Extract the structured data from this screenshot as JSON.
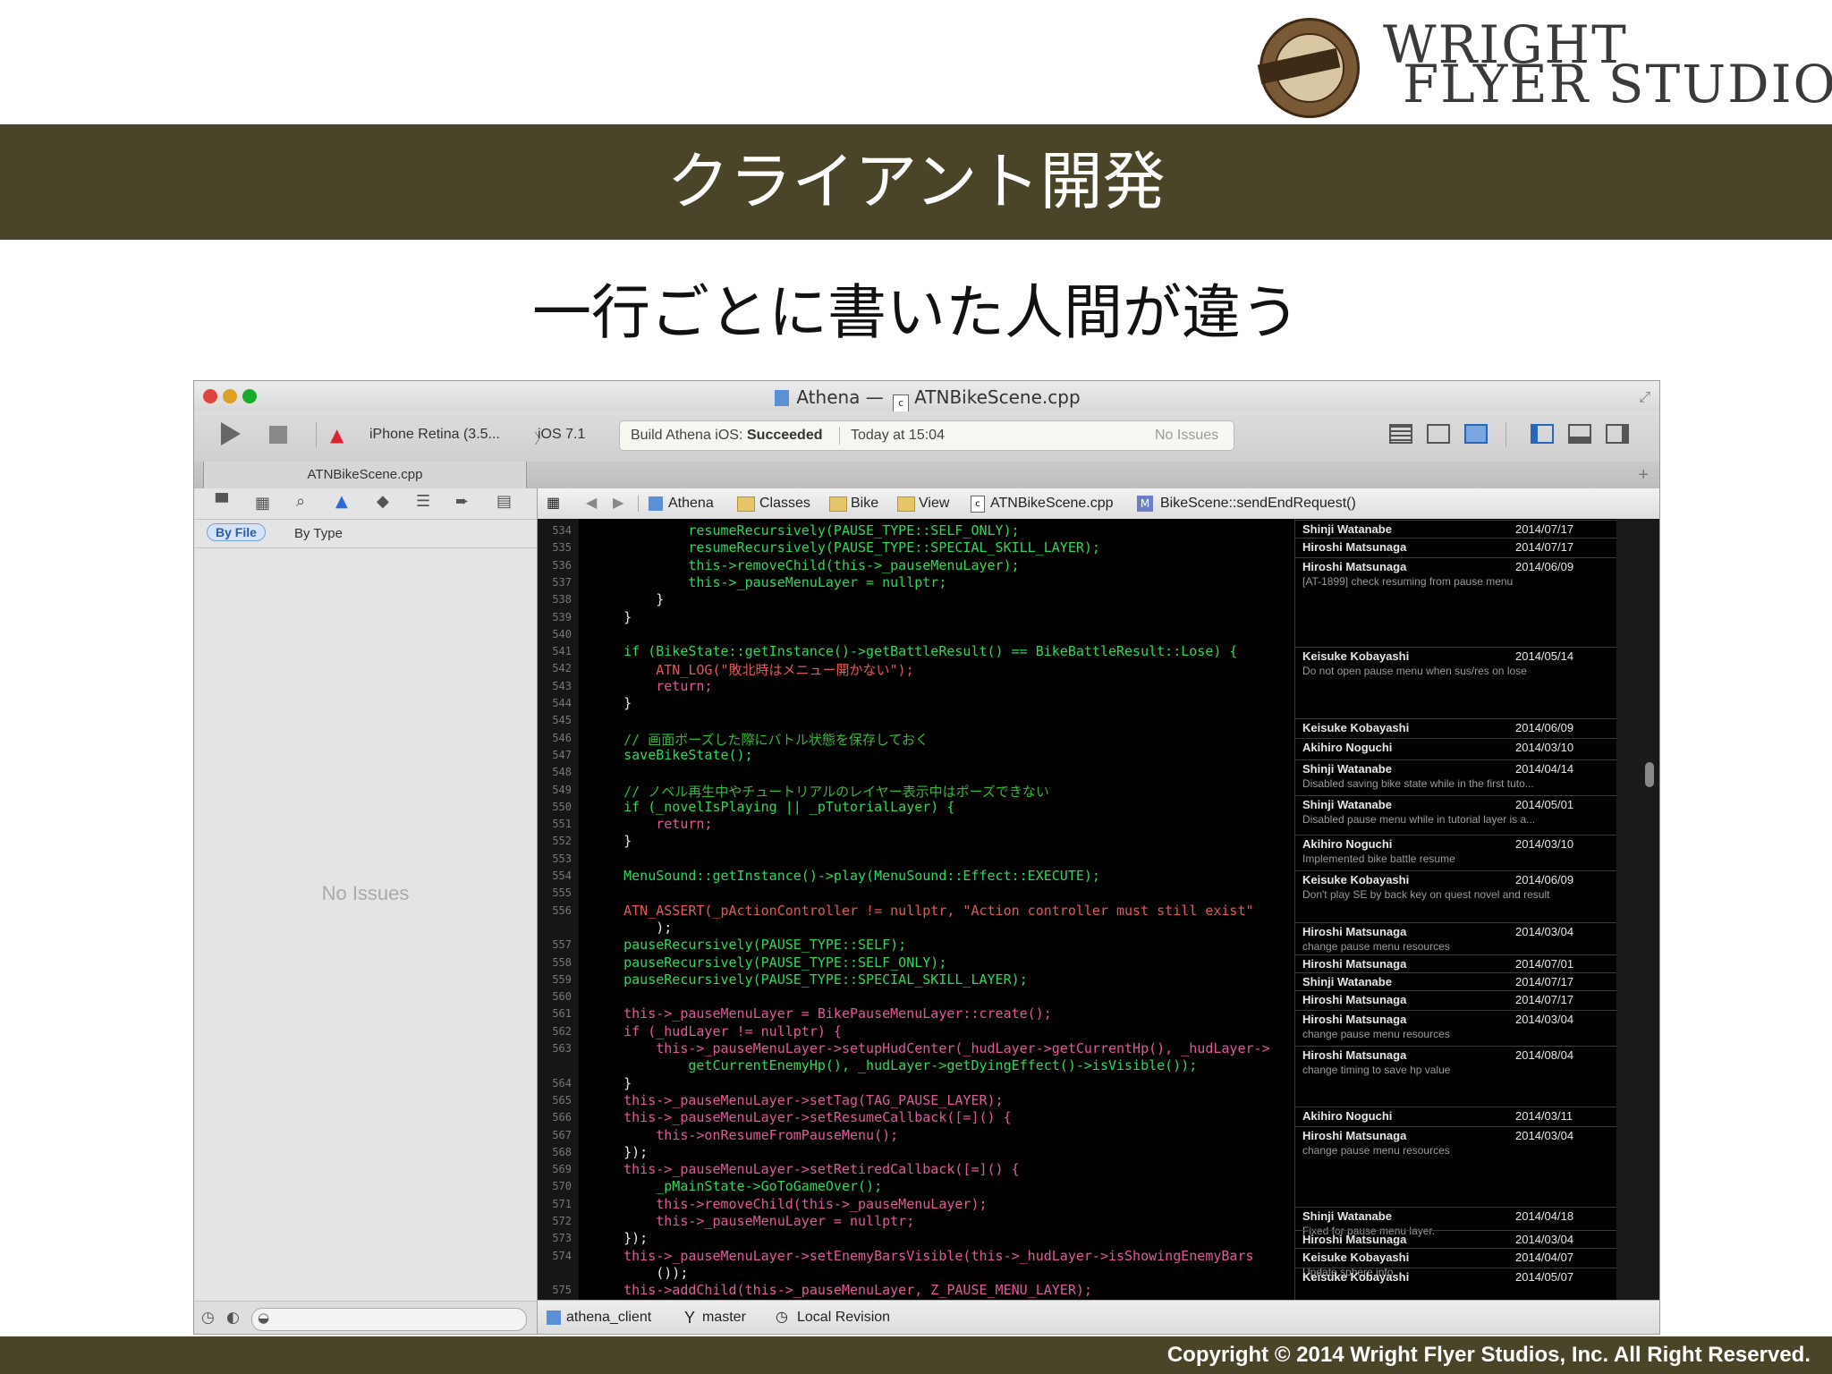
{
  "logo": {
    "line1": "WRIGHT",
    "line2": "FLYER STUDIOS"
  },
  "slide": {
    "title": "クライアント開発",
    "subtitle": "一行ごとに書いた人間が違う",
    "footer": "Copyright © 2014 Wright Flyer Studios, Inc. All Right Reserved."
  },
  "window": {
    "title_project": "Athena",
    "title_sep": "—",
    "title_file": "ATNBikeScene.cpp"
  },
  "toolbar": {
    "scheme_device": "iPhone Retina (3.5...",
    "scheme_os": "iOS 7.1",
    "status_prefix": "Build Athena iOS:",
    "status_result": "Succeeded",
    "status_time": "Today at 15:04",
    "status_issues": "No Issues"
  },
  "tab": {
    "label": "ATNBikeScene.cpp",
    "add": "+"
  },
  "navigator": {
    "filter_by_file": "By File",
    "filter_by_type": "By Type",
    "empty_message": "No Issues"
  },
  "jumpbar": {
    "items": [
      "Athena",
      "Classes",
      "Bike",
      "View",
      "ATNBikeScene.cpp",
      "BikeScene::sendEndRequest()"
    ]
  },
  "code_lines": [
    {
      "n": "534",
      "t": "            resumeRecursively(PAUSE_TYPE::SELF_ONLY);",
      "c": "#2fd85a"
    },
    {
      "n": "535",
      "t": "            resumeRecursively(PAUSE_TYPE::SPECIAL_SKILL_LAYER);",
      "c": "#2fd85a"
    },
    {
      "n": "536",
      "t": "            this->removeChild(this->_pauseMenuLayer);",
      "c": "#2fd85a"
    },
    {
      "n": "537",
      "t": "            this->_pauseMenuLayer = nullptr;",
      "c": "#2fd85a"
    },
    {
      "n": "538",
      "t": "        }",
      "c": "#e8e8e8"
    },
    {
      "n": "539",
      "t": "    }",
      "c": "#e8e8e8"
    },
    {
      "n": "540",
      "t": "",
      "c": "#e8e8e8"
    },
    {
      "n": "541",
      "t": "    if (BikeState::getInstance()->getBattleResult() == BikeBattleResult::Lose) {",
      "c": "#2fd85a"
    },
    {
      "n": "542",
      "t": "        ATN_LOG(\"敗北時はメニュー開かない\");",
      "c": "#e05a5a"
    },
    {
      "n": "543",
      "t": "        return;",
      "c": "#e05a9a"
    },
    {
      "n": "544",
      "t": "    }",
      "c": "#e8e8e8"
    },
    {
      "n": "545",
      "t": "",
      "c": "#e8e8e8"
    },
    {
      "n": "546",
      "t": "    // 画面ポーズした際にバトル状態を保存しておく",
      "c": "#38b838"
    },
    {
      "n": "547",
      "t": "    saveBikeState();",
      "c": "#2fd85a"
    },
    {
      "n": "548",
      "t": "",
      "c": "#e8e8e8"
    },
    {
      "n": "549",
      "t": "    // ノベル再生中やチュートリアルのレイヤー表示中はポーズできない",
      "c": "#38b838"
    },
    {
      "n": "550",
      "t": "    if (_novelIsPlaying || _pTutorialLayer) {",
      "c": "#2fd85a"
    },
    {
      "n": "551",
      "t": "        return;",
      "c": "#e05a9a"
    },
    {
      "n": "552",
      "t": "    }",
      "c": "#e8e8e8"
    },
    {
      "n": "553",
      "t": "",
      "c": "#e8e8e8"
    },
    {
      "n": "554",
      "t": "    MenuSound::getInstance()->play(MenuSound::Effect::EXECUTE);",
      "c": "#2fd85a"
    },
    {
      "n": "555",
      "t": "",
      "c": "#e8e8e8"
    },
    {
      "n": "556",
      "t": "    ATN_ASSERT(_pActionController != nullptr, \"Action controller must still exist\"",
      "c": "#e05a5a"
    },
    {
      "n": "",
      "t": "        );",
      "c": "#e8e8e8"
    },
    {
      "n": "557",
      "t": "    pauseRecursively(PAUSE_TYPE::SELF);",
      "c": "#2fd85a"
    },
    {
      "n": "558",
      "t": "    pauseRecursively(PAUSE_TYPE::SELF_ONLY);",
      "c": "#2fd85a"
    },
    {
      "n": "559",
      "t": "    pauseRecursively(PAUSE_TYPE::SPECIAL_SKILL_LAYER);",
      "c": "#2fd85a"
    },
    {
      "n": "560",
      "t": "",
      "c": "#e8e8e8"
    },
    {
      "n": "561",
      "t": "    this->_pauseMenuLayer = BikePauseMenuLayer::create();",
      "c": "#e05a9a"
    },
    {
      "n": "562",
      "t": "    if (_hudLayer != nullptr) {",
      "c": "#e05a9a"
    },
    {
      "n": "563",
      "t": "        this->_pauseMenuLayer->setupHudCenter(_hudLayer->getCurrentHp(), _hudLayer->",
      "c": "#e05a9a"
    },
    {
      "n": "",
      "t": "            getCurrentEnemyHp(), _hudLayer->getDyingEffect()->isVisible());",
      "c": "#2fd85a"
    },
    {
      "n": "564",
      "t": "    }",
      "c": "#e8e8e8"
    },
    {
      "n": "565",
      "t": "    this->_pauseMenuLayer->setTag(TAG_PAUSE_LAYER);",
      "c": "#e05a9a"
    },
    {
      "n": "566",
      "t": "    this->_pauseMenuLayer->setResumeCallback([=]() {",
      "c": "#e05a9a"
    },
    {
      "n": "567",
      "t": "        this->onResumeFromPauseMenu();",
      "c": "#e05a9a"
    },
    {
      "n": "568",
      "t": "    });",
      "c": "#e8e8e8"
    },
    {
      "n": "569",
      "t": "    this->_pauseMenuLayer->setRetiredCallback([=]() {",
      "c": "#e05a9a"
    },
    {
      "n": "570",
      "t": "        _pMainState->GoToGameOver();",
      "c": "#2fd85a"
    },
    {
      "n": "571",
      "t": "        this->removeChild(this->_pauseMenuLayer);",
      "c": "#e05a9a"
    },
    {
      "n": "572",
      "t": "        this->_pauseMenuLayer = nullptr;",
      "c": "#e05a9a"
    },
    {
      "n": "573",
      "t": "    });",
      "c": "#e8e8e8"
    },
    {
      "n": "574",
      "t": "    this->_pauseMenuLayer->setEnemyBarsVisible(this->_hudLayer->isShowingEnemyBars",
      "c": "#e05a9a"
    },
    {
      "n": "",
      "t": "        ());",
      "c": "#e8e8e8"
    },
    {
      "n": "575",
      "t": "    this->addChild(this->_pauseMenuLayer, Z_PAUSE_MENU_LAYER);",
      "c": "#e05a9a"
    }
  ],
  "blame": [
    {
      "name": "Shinji Watanabe",
      "date": "2014/07/17",
      "msg": ""
    },
    {
      "name": "Hiroshi Matsunaga",
      "date": "2014/07/17",
      "msg": ""
    },
    {
      "name": "Hiroshi Matsunaga",
      "date": "2014/06/09",
      "msg": "[AT-1899] check resuming from pause menu"
    },
    {
      "name": "Keisuke Kobayashi",
      "date": "2014/05/14",
      "msg": "Do not open pause menu when sus/res on lose"
    },
    {
      "name": "Keisuke Kobayashi",
      "date": "2014/06/09",
      "msg": ""
    },
    {
      "name": "Akihiro Noguchi",
      "date": "2014/03/10",
      "msg": ""
    },
    {
      "name": "Shinji Watanabe",
      "date": "2014/04/14",
      "msg": "Disabled saving bike state while in the first tuto..."
    },
    {
      "name": "Shinji Watanabe",
      "date": "2014/05/01",
      "msg": "Disabled pause menu while in tutorial layer is a..."
    },
    {
      "name": "Akihiro Noguchi",
      "date": "2014/03/10",
      "msg": "Implemented bike battle resume"
    },
    {
      "name": "Keisuke Kobayashi",
      "date": "2014/06/09",
      "msg": "Don't play SE by back key on quest novel and result"
    },
    {
      "name": "Hiroshi Matsunaga",
      "date": "2014/03/04",
      "msg": "change pause menu resources"
    },
    {
      "name": "Hiroshi Matsunaga",
      "date": "2014/07/01",
      "msg": ""
    },
    {
      "name": "Shinji Watanabe",
      "date": "2014/07/17",
      "msg": ""
    },
    {
      "name": "Hiroshi Matsunaga",
      "date": "2014/07/17",
      "msg": ""
    },
    {
      "name": "Hiroshi Matsunaga",
      "date": "2014/03/04",
      "msg": "change pause menu resources"
    },
    {
      "name": "Hiroshi Matsunaga",
      "date": "2014/08/04",
      "msg": "change timing to save hp value"
    },
    {
      "name": "Akihiro Noguchi",
      "date": "2014/03/11",
      "msg": ""
    },
    {
      "name": "Hiroshi Matsunaga",
      "date": "2014/03/04",
      "msg": "change pause menu resources"
    },
    {
      "name": "Shinji Watanabe",
      "date": "2014/04/18",
      "msg": "Fixed for pause menu layer."
    },
    {
      "name": "Hiroshi Matsunaga",
      "date": "2014/03/04",
      "msg": ""
    },
    {
      "name": "Keisuke Kobayashi",
      "date": "2014/04/07",
      "msg": "Update sphere info"
    },
    {
      "name": "Keisuke Kobayashi",
      "date": "2014/05/07",
      "msg": ""
    }
  ],
  "source_control": {
    "repo": "athena_client",
    "branch": "master",
    "revision": "Local Revision"
  },
  "colors": {
    "band": "#4a4429",
    "editor_bg": "#000000"
  },
  "icons": [
    "run-icon",
    "stop-icon",
    "xcode-icon",
    "navigator-folder-icon",
    "search-icon",
    "warning-icon",
    "breakpoint-icon",
    "list-icon",
    "tag-icon",
    "log-icon",
    "grid-icon",
    "back-icon",
    "forward-icon",
    "branch-icon",
    "clock-icon"
  ]
}
